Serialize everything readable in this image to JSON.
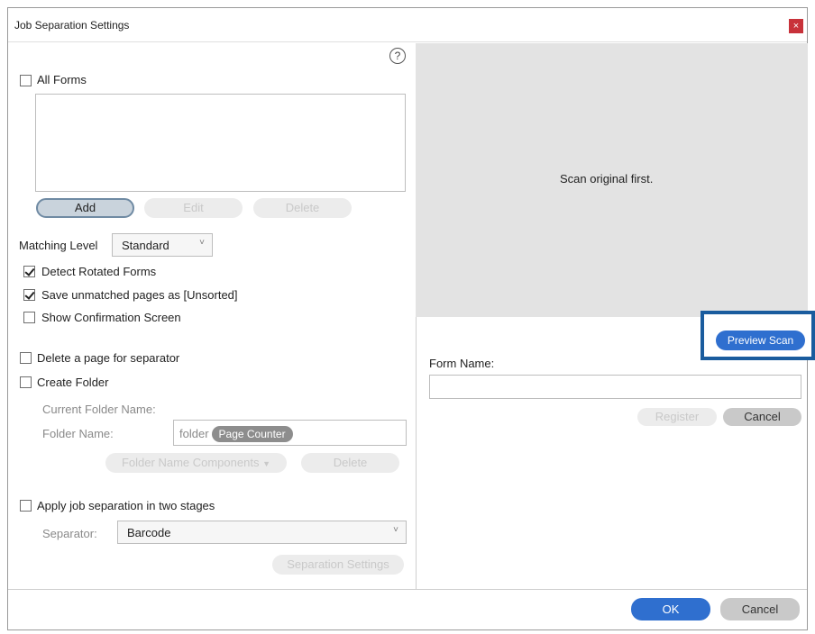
{
  "window": {
    "title": "Job Separation Settings",
    "close_label": "×"
  },
  "help_icon": "?",
  "forms": {
    "all_forms_label": "All Forms",
    "all_forms_checked": false,
    "add_label": "Add",
    "edit_label": "Edit",
    "delete_label": "Delete"
  },
  "matching": {
    "label": "Matching Level",
    "value": "Standard"
  },
  "options": {
    "detect_rotated": {
      "label": "Detect Rotated Forms",
      "checked": true
    },
    "save_unmatched": {
      "label": "Save unmatched pages as [Unsorted]",
      "checked": true
    },
    "show_confirmation": {
      "label": "Show Confirmation Screen",
      "checked": false
    },
    "delete_separator": {
      "label": "Delete a page for separator",
      "checked": false
    },
    "create_folder": {
      "label": "Create Folder",
      "checked": false
    }
  },
  "folder": {
    "current_label": "Current Folder Name:",
    "name_label": "Folder Name:",
    "name_prefix": "folder",
    "name_tag": "Page Counter",
    "components_label": "Folder Name Components",
    "components_arrow": "▼",
    "delete_label": "Delete"
  },
  "two_stage": {
    "label": "Apply job separation in two stages",
    "checked": false,
    "separator_label": "Separator:",
    "separator_value": "Barcode",
    "settings_label": "Separation Settings"
  },
  "preview": {
    "message": "Scan original first.",
    "preview_scan_label": "Preview Scan"
  },
  "form_name": {
    "label": "Form Name:",
    "value": "",
    "register_label": "Register",
    "cancel_label": "Cancel"
  },
  "footer": {
    "ok_label": "OK",
    "cancel_label": "Cancel"
  },
  "colors": {
    "accent": "#2f6fcf",
    "highlight_border": "#1a5c9e",
    "close": "#c8323a"
  }
}
